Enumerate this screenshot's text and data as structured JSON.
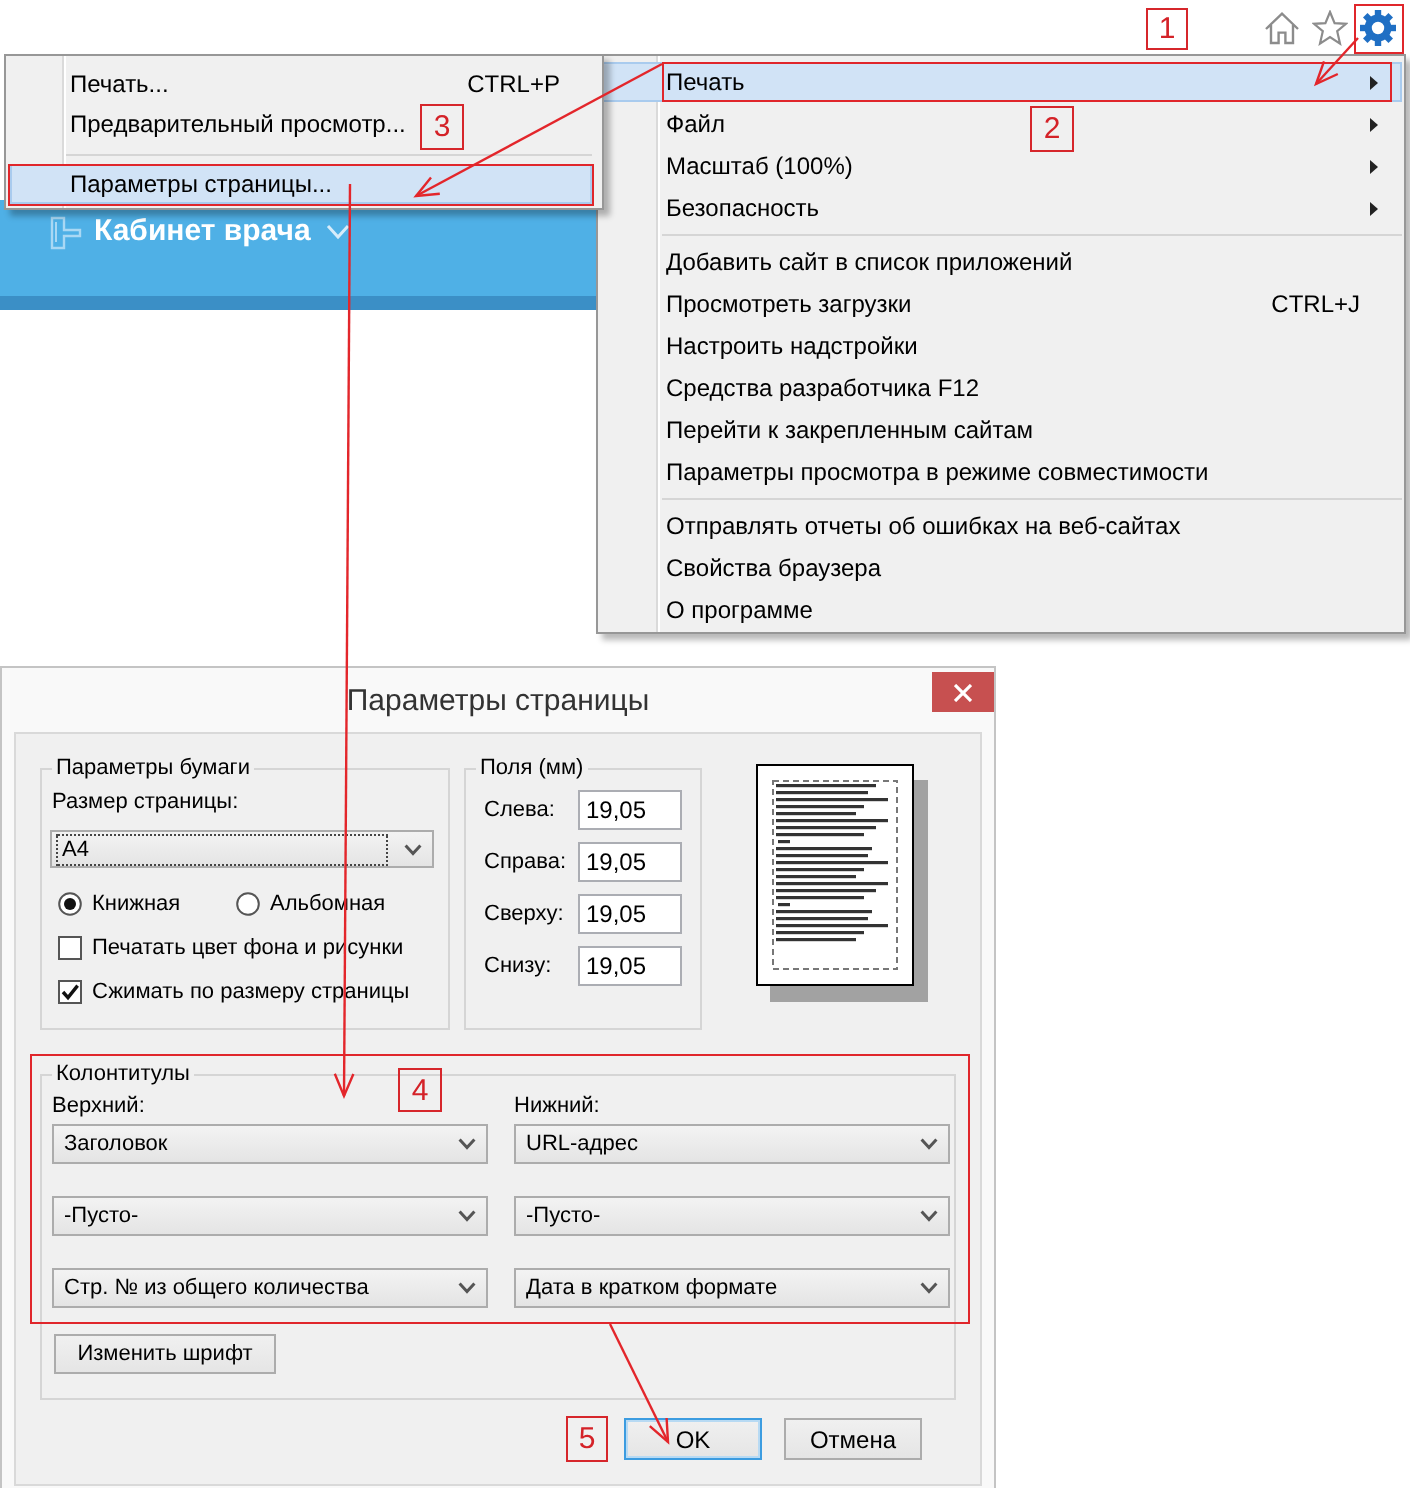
{
  "page_header": {
    "title": "Кабинет врача"
  },
  "print_submenu": {
    "groups": [
      {
        "items": [
          {
            "label": "Печать...",
            "shortcut": "CTRL+P",
            "selected": false
          },
          {
            "label": "Предварительный просмотр...",
            "selected": false
          }
        ]
      },
      {
        "items": [
          {
            "label": "Параметры страницы...",
            "selected": true
          }
        ]
      }
    ]
  },
  "tools_menu": {
    "groups": [
      {
        "items": [
          {
            "label": "Печать",
            "submenu": true,
            "selected": true
          },
          {
            "label": "Файл",
            "submenu": true,
            "selected": false
          },
          {
            "label": "Масштаб (100%)",
            "submenu": true,
            "selected": false
          },
          {
            "label": "Безопасность",
            "submenu": true,
            "selected": false
          }
        ]
      },
      {
        "items": [
          {
            "label": "Добавить сайт в список приложений",
            "submenu": false,
            "selected": false
          },
          {
            "label": "Просмотреть загрузки",
            "shortcut": "CTRL+J",
            "submenu": false,
            "selected": false
          },
          {
            "label": "Настроить надстройки",
            "submenu": false,
            "selected": false
          },
          {
            "label": "Средства разработчика F12",
            "submenu": false,
            "selected": false
          },
          {
            "label": "Перейти к закрепленным сайтам",
            "submenu": false,
            "selected": false
          },
          {
            "label": "Параметры просмотра в режиме совместимости",
            "submenu": false,
            "selected": false
          }
        ]
      },
      {
        "items": [
          {
            "label": "Отправлять отчеты об ошибках на веб-сайтах",
            "submenu": false,
            "selected": false
          },
          {
            "label": "Свойства браузера",
            "submenu": false,
            "selected": false
          },
          {
            "label": "О программе",
            "submenu": false,
            "selected": false
          }
        ]
      }
    ]
  },
  "dialog": {
    "title": "Параметры страницы",
    "paper": {
      "legend": "Параметры бумаги",
      "size_label": "Размер страницы:",
      "size": {
        "value": "A4",
        "focused": true
      },
      "orientation": [
        {
          "label": "Книжная",
          "selected": true
        },
        {
          "label": "Альбомная",
          "selected": false
        }
      ],
      "options": [
        {
          "label": "Печатать цвет фона и рисунки",
          "checked": false
        },
        {
          "label": "Сжимать по размеру страницы",
          "checked": true
        }
      ]
    },
    "margins": {
      "legend": "Поля (мм)",
      "fields": [
        {
          "label": "Слева:",
          "value": "19,05"
        },
        {
          "label": "Справа:",
          "value": "19,05"
        },
        {
          "label": "Сверху:",
          "value": "19,05"
        },
        {
          "label": "Снизу:",
          "value": "19,05"
        }
      ]
    },
    "headers_footers": {
      "legend": "Колонтитулы",
      "columns": [
        {
          "label": "Верхний:",
          "values": [
            "Заголовок",
            "-Пусто-",
            "Стр. № из общего количества"
          ]
        },
        {
          "label": "Нижний:",
          "values": [
            "URL-адрес",
            "-Пусто-",
            "Дата в кратком формате"
          ]
        }
      ],
      "font_button": "Изменить шрифт"
    },
    "buttons": [
      {
        "label": "OK",
        "default": true
      },
      {
        "label": "Отмена",
        "default": false
      }
    ]
  },
  "annotations": [
    {
      "number": "1"
    },
    {
      "number": "2"
    },
    {
      "number": "3"
    },
    {
      "number": "4"
    },
    {
      "number": "5"
    }
  ]
}
